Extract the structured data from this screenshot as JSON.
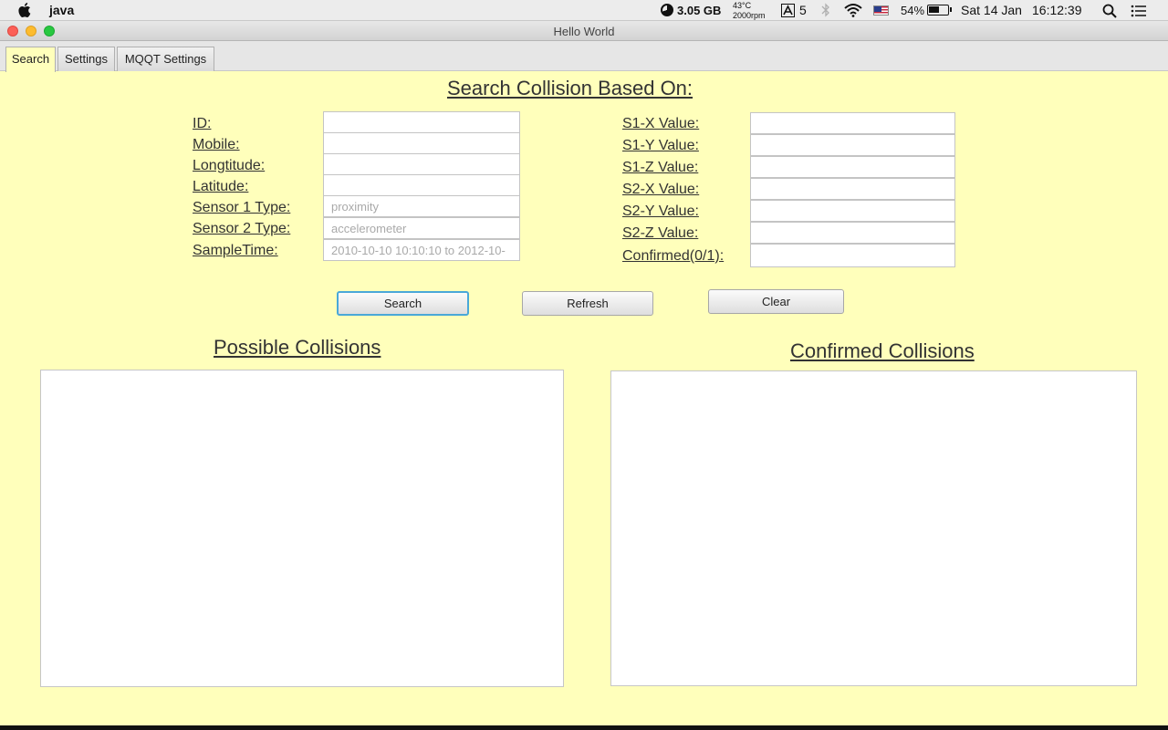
{
  "menubar": {
    "app_name": "java",
    "memory": "3.05 GB",
    "temperature": "43°C",
    "fan": "2000rpm",
    "adobe_count": "5",
    "battery": "54%",
    "date": "Sat 14 Jan",
    "time": "16:12:39"
  },
  "window": {
    "title": "Hello World",
    "tabs": [
      {
        "label": "Search"
      },
      {
        "label": "Settings"
      },
      {
        "label": "MQQT Settings"
      }
    ]
  },
  "form": {
    "heading": "Search Collision Based On:",
    "left_fields": [
      {
        "label": "ID:",
        "value": "",
        "placeholder": ""
      },
      {
        "label": "Mobile:",
        "value": "",
        "placeholder": ""
      },
      {
        "label": "Longtitude:",
        "value": "",
        "placeholder": ""
      },
      {
        "label": "Latitude:",
        "value": "",
        "placeholder": ""
      },
      {
        "label": "Sensor 1 Type:",
        "value": "",
        "placeholder": "proximity"
      },
      {
        "label": "Sensor 2 Type:",
        "value": "",
        "placeholder": "accelerometer"
      },
      {
        "label": "SampleTime:",
        "value": "",
        "placeholder": "2010-10-10 10:10:10 to 2012-10-"
      }
    ],
    "right_fields": [
      {
        "label": "S1-X Value:",
        "value": ""
      },
      {
        "label": "S1-Y Value:",
        "value": ""
      },
      {
        "label": "S1-Z Value:",
        "value": ""
      },
      {
        "label": "S2-X Value:",
        "value": ""
      },
      {
        "label": "S2-Y Value:",
        "value": ""
      },
      {
        "label": "S2-Z Value:",
        "value": ""
      },
      {
        "label": "Confirmed(0/1):",
        "value": ""
      }
    ],
    "buttons": {
      "search": "Search",
      "refresh": "Refresh",
      "clear": "Clear"
    }
  },
  "results": {
    "possible_heading": "Possible Collisions",
    "confirmed_heading": "Confirmed Collisions"
  },
  "colors": {
    "window_background": "#ffffbb",
    "focus_ring": "#4aa8d8"
  }
}
